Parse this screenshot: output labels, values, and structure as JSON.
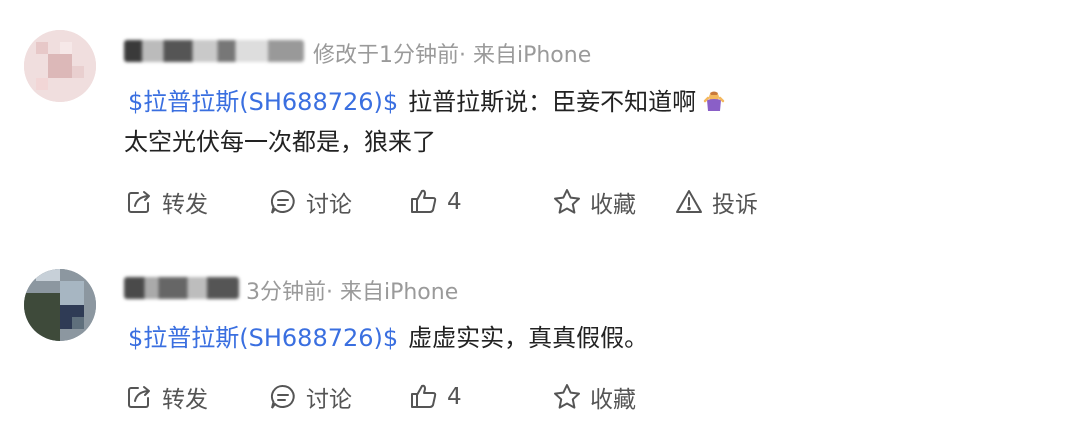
{
  "posts": [
    {
      "meta": "修改于1分钟前· 来自iPhone",
      "stock_link": "$拉普拉斯(SH688726)$",
      "text_line1": "拉普拉斯说：臣妾不知道啊",
      "text_line2": "太空光伏每一次都是，狼来了",
      "emoji": "person-shrugging-emoji",
      "actions": {
        "repost": "转发",
        "comment": "讨论",
        "like": "4",
        "favorite": "收藏",
        "report": "投诉"
      }
    },
    {
      "meta": "3分钟前· 来自iPhone",
      "stock_link": "$拉普拉斯(SH688726)$",
      "text_line1": "虚虚实实，真真假假。",
      "actions": {
        "repost": "转发",
        "comment": "讨论",
        "like": "4",
        "favorite": "收藏"
      }
    }
  ],
  "colors": {
    "link": "#3a6fe0",
    "meta": "#9a9a9a",
    "action": "#555555"
  }
}
